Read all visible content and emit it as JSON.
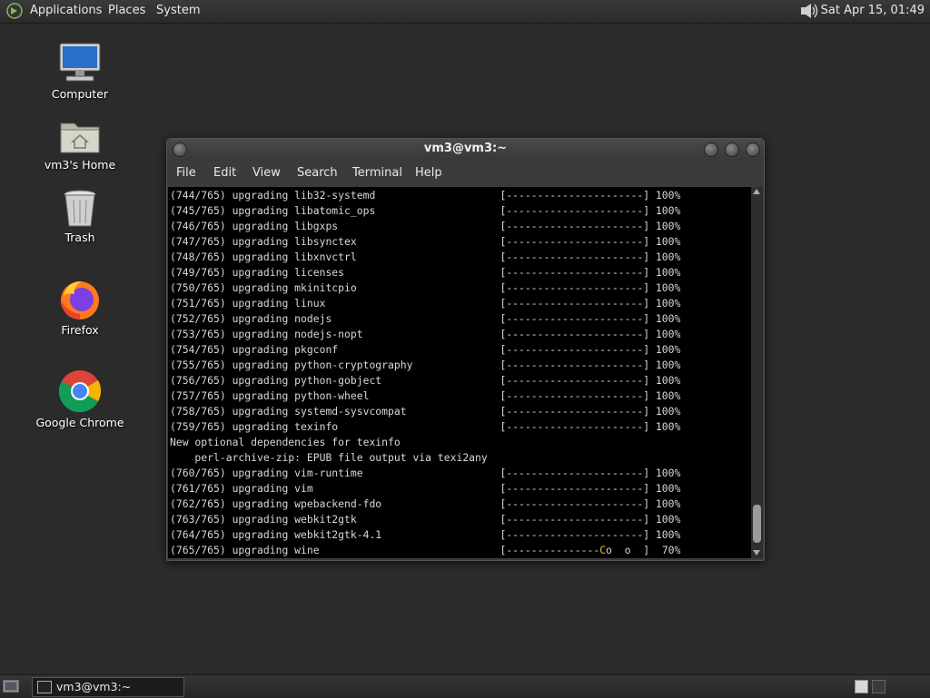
{
  "top_panel": {
    "menus": [
      "Applications",
      "Places",
      "System"
    ],
    "clock": "Sat Apr 15, 01:49"
  },
  "desktop_icons": [
    {
      "label": "Computer",
      "icon": "computer-icon"
    },
    {
      "label": "vm3's Home",
      "icon": "home-folder-icon"
    },
    {
      "label": "Trash",
      "icon": "trash-icon"
    },
    {
      "label": "Firefox",
      "icon": "firefox-icon"
    },
    {
      "label": "Google Chrome",
      "icon": "chrome-icon"
    }
  ],
  "terminal": {
    "title": "vm3@vm3:~",
    "menu": [
      "File",
      "Edit",
      "View",
      "Search",
      "Terminal",
      "Help"
    ],
    "lines": [
      "(744/765) upgrading lib32-systemd                    [----------------------] 100%",
      "(745/765) upgrading libatomic_ops                    [----------------------] 100%",
      "(746/765) upgrading libgxps                          [----------------------] 100%",
      "(747/765) upgrading libsynctex                       [----------------------] 100%",
      "(748/765) upgrading libxnvctrl                       [----------------------] 100%",
      "(749/765) upgrading licenses                         [----------------------] 100%",
      "(750/765) upgrading mkinitcpio                       [----------------------] 100%",
      "(751/765) upgrading linux                            [----------------------] 100%",
      "(752/765) upgrading nodejs                           [----------------------] 100%",
      "(753/765) upgrading nodejs-nopt                      [----------------------] 100%",
      "(754/765) upgrading pkgconf                          [----------------------] 100%",
      "(755/765) upgrading python-cryptography              [----------------------] 100%",
      "(756/765) upgrading python-gobject                   [----------------------] 100%",
      "(757/765) upgrading python-wheel                     [----------------------] 100%",
      "(758/765) upgrading systemd-sysvcompat               [----------------------] 100%",
      "(759/765) upgrading texinfo                          [----------------------] 100%",
      "New optional dependencies for texinfo",
      "    perl-archive-zip: EPUB file output via texi2any",
      "(760/765) upgrading vim-runtime                      [----------------------] 100%",
      "(761/765) upgrading vim                              [----------------------] 100%",
      "(762/765) upgrading wpebackend-fdo                   [----------------------] 100%",
      "(763/765) upgrading webkit2gtk                       [----------------------] 100%",
      "(764/765) upgrading webkit2gtk-4.1                   [----------------------] 100%"
    ],
    "last_line_prefix": "(765/765) upgrading wine                             [---------------",
    "last_line_pacman": "C",
    "last_line_dots": "o  o  ]  70%"
  },
  "taskbar": {
    "task_label": "vm3@vm3:~"
  }
}
